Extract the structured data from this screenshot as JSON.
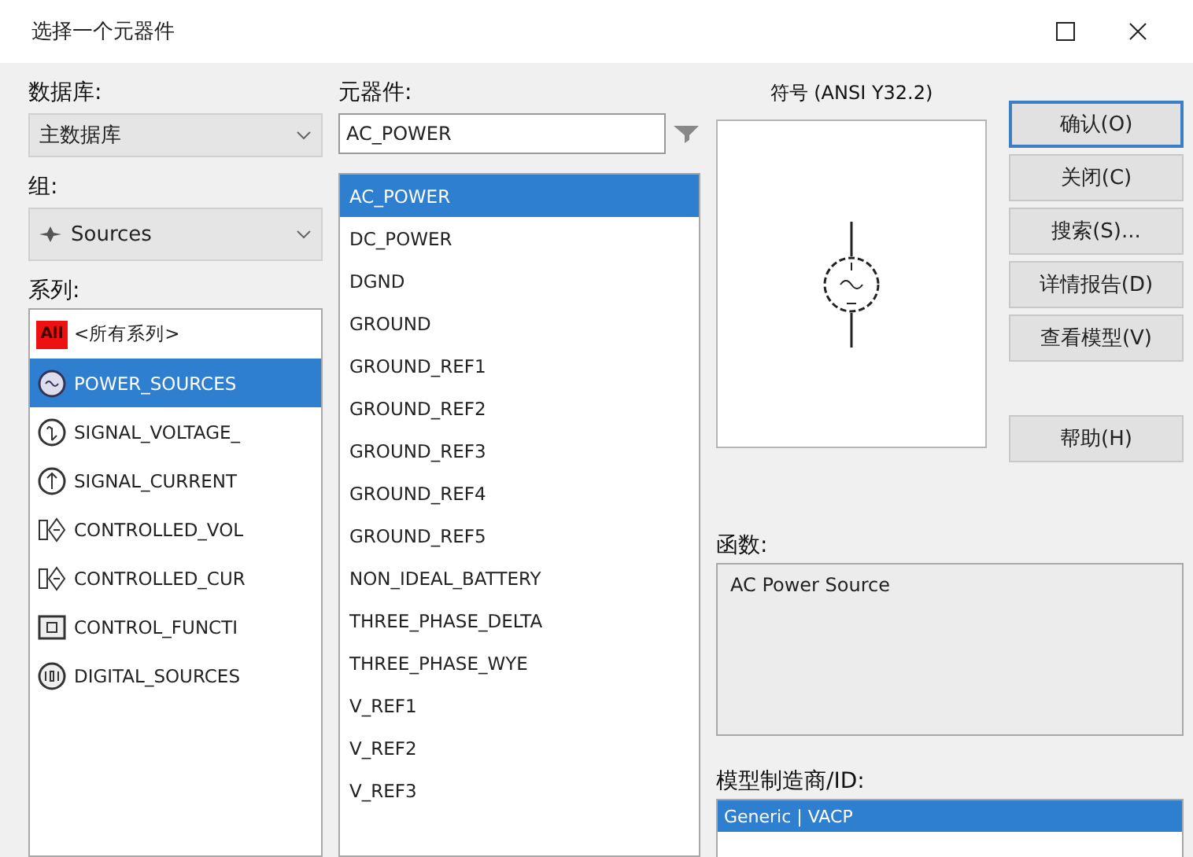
{
  "window": {
    "title": "选择一个元器件"
  },
  "database": {
    "label": "数据库:",
    "value": "主数据库"
  },
  "group": {
    "label": "组:",
    "value": "Sources"
  },
  "family": {
    "label": "系列:",
    "items": [
      {
        "kind": "all",
        "icon_label": "All",
        "label": "<所有系列>",
        "selected": false
      },
      {
        "kind": "power",
        "label": "POWER_SOURCES",
        "selected": true
      },
      {
        "kind": "signal_voltage",
        "label": "SIGNAL_VOLTAGE_",
        "selected": false
      },
      {
        "kind": "signal_current",
        "label": "SIGNAL_CURRENT",
        "selected": false
      },
      {
        "kind": "controlled_voltage",
        "label": "CONTROLLED_VOL",
        "selected": false
      },
      {
        "kind": "controlled_current",
        "label": "CONTROLLED_CUR",
        "selected": false
      },
      {
        "kind": "control_function",
        "label": "CONTROL_FUNCTI",
        "selected": false
      },
      {
        "kind": "digital",
        "label": "DIGITAL_SOURCES",
        "selected": false
      }
    ]
  },
  "component": {
    "label": "元器件:",
    "value": "AC_POWER",
    "items": [
      {
        "label": "AC_POWER",
        "selected": true
      },
      {
        "label": "DC_POWER",
        "selected": false
      },
      {
        "label": "DGND",
        "selected": false
      },
      {
        "label": "GROUND",
        "selected": false
      },
      {
        "label": "GROUND_REF1",
        "selected": false
      },
      {
        "label": "GROUND_REF2",
        "selected": false
      },
      {
        "label": "GROUND_REF3",
        "selected": false
      },
      {
        "label": "GROUND_REF4",
        "selected": false
      },
      {
        "label": "GROUND_REF5",
        "selected": false
      },
      {
        "label": "NON_IDEAL_BATTERY",
        "selected": false
      },
      {
        "label": "THREE_PHASE_DELTA",
        "selected": false
      },
      {
        "label": "THREE_PHASE_WYE",
        "selected": false
      },
      {
        "label": "V_REF1",
        "selected": false
      },
      {
        "label": "V_REF2",
        "selected": false
      },
      {
        "label": "V_REF3",
        "selected": false
      }
    ]
  },
  "symbol": {
    "label": "符号 (ANSI Y32.2)"
  },
  "buttons": [
    {
      "label": "确认(O)",
      "default": true
    },
    {
      "label": "关闭(C)",
      "default": false
    },
    {
      "label": "搜索(S)...",
      "default": false
    },
    {
      "label": "详情报告(D)",
      "default": false
    },
    {
      "label": "查看模型(V)",
      "default": false
    },
    {
      "label": "帮助(H)",
      "default": false
    }
  ],
  "function": {
    "label": "函数:",
    "value": "AC Power Source"
  },
  "model": {
    "label": "模型制造商/ID:",
    "items": [
      {
        "label": "Generic | VACP",
        "selected": true
      }
    ]
  }
}
